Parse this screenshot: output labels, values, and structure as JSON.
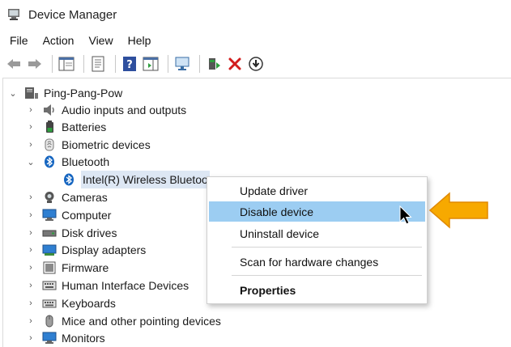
{
  "window": {
    "title": "Device Manager"
  },
  "menu": [
    "File",
    "Action",
    "View",
    "Help"
  ],
  "tree": {
    "root": "Ping-Pang-Pow",
    "categories": [
      {
        "label": "Audio inputs and outputs",
        "icon": "speaker-icon",
        "expanded": false
      },
      {
        "label": "Batteries",
        "icon": "battery-icon",
        "expanded": false
      },
      {
        "label": "Biometric devices",
        "icon": "fingerprint-icon",
        "expanded": false
      },
      {
        "label": "Bluetooth",
        "icon": "bluetooth-icon",
        "expanded": true
      },
      {
        "label": "Cameras",
        "icon": "camera-icon",
        "expanded": false
      },
      {
        "label": "Computer",
        "icon": "computer-icon",
        "expanded": false
      },
      {
        "label": "Disk drives",
        "icon": "disk-drive-icon",
        "expanded": false
      },
      {
        "label": "Display adapters",
        "icon": "display-adapter-icon",
        "expanded": false
      },
      {
        "label": "Firmware",
        "icon": "firmware-icon",
        "expanded": false
      },
      {
        "label": "Human Interface Devices",
        "icon": "hid-icon",
        "expanded": false
      },
      {
        "label": "Keyboards",
        "icon": "keyboard-icon",
        "expanded": false
      },
      {
        "label": "Mice and other pointing devices",
        "icon": "mouse-icon",
        "expanded": false
      },
      {
        "label": "Monitors",
        "icon": "monitor-icon",
        "expanded": false
      }
    ],
    "bluetooth_child": "Intel(R) Wireless Bluetoo"
  },
  "context_menu": {
    "items": [
      {
        "label": "Update driver",
        "highlighted": false,
        "bold": false
      },
      {
        "label": "Disable device",
        "highlighted": true,
        "bold": false
      },
      {
        "label": "Uninstall device",
        "highlighted": false,
        "bold": false
      },
      {
        "label": "Scan for hardware changes",
        "highlighted": false,
        "bold": false
      },
      {
        "label": "Properties",
        "highlighted": false,
        "bold": true
      }
    ]
  },
  "colors": {
    "highlight": "#9ccdf2",
    "callout_arrow": "#f7a900",
    "bluetooth_blue": "#1565c0",
    "uninstall_red": "#d21d1d"
  }
}
